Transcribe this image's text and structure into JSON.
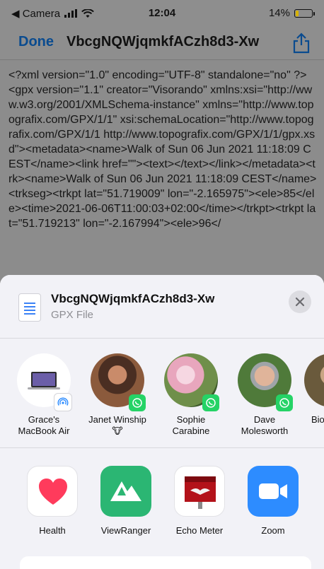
{
  "status": {
    "carrier": "◀ Camera",
    "time": "12:04",
    "battery": "14%",
    "battery_level": 0.14
  },
  "nav": {
    "done_label": "Done",
    "title": "VbcgNQWjqmkfACzh8d3-Xw"
  },
  "document": {
    "content": "<?xml version=\"1.0\" encoding=\"UTF-8\" standalone=\"no\" ?>\n<gpx version=\"1.1\" creator=\"Visorando\" xmlns:xsi=\"http://www.w3.org/2001/XMLSchema-instance\" xmlns=\"http://www.topografix.com/GPX/1/1\" xsi:schemaLocation=\"http://www.topografix.com/GPX/1/1 http://www.topografix.com/GPX/1/1/gpx.xsd\"><metadata><name>Walk of Sun 06 Jun 2021 11:18:09 CEST</name><link href=\"\"><text></text></link></metadata><trk><name>Walk of Sun 06 Jun 2021 11:18:09 CEST</name><trkseg><trkpt lat=\"51.719009\" lon=\"-2.165975\"><ele>85</ele><time>2021-06-06T11:00:03+02:00</time></trkpt><trkpt lat=\"51.719213\" lon=\"-2.167994\"><ele>96</"
  },
  "share": {
    "file_name": "VbcgNQWjqmkfACzh8d3-Xw",
    "file_type": "GPX File",
    "people": [
      {
        "name": "Grace's MacBook Air",
        "kind": "airdrop"
      },
      {
        "name": "Janet Winship 🐮",
        "kind": "whatsapp"
      },
      {
        "name": "Sophie Carabine",
        "kind": "whatsapp"
      },
      {
        "name": "Dave Molesworth",
        "kind": "whatsapp"
      },
      {
        "name": "Bio",
        "kind": "whatsapp"
      }
    ],
    "apps": [
      {
        "name": "Health",
        "icon": "heart-icon"
      },
      {
        "name": "ViewRanger",
        "icon": "mountains-icon"
      },
      {
        "name": "Echo Meter",
        "icon": "bat-icon"
      },
      {
        "name": "Zoom",
        "icon": "video-camera-icon"
      }
    ]
  },
  "colors": {
    "accent": "#0a4b8f",
    "whatsapp": "#25d366",
    "zoom": "#2d8cff",
    "viewranger": "#2bb673"
  }
}
